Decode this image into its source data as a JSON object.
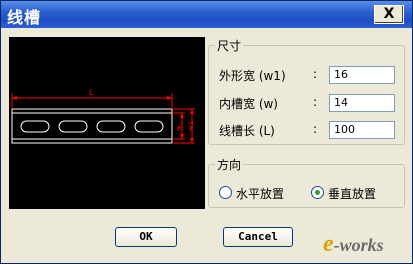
{
  "window": {
    "title": "线槽",
    "close_label": "X"
  },
  "preview": {
    "dim_l": "L",
    "dim_w": "w",
    "dim_w1": "w1"
  },
  "size_group": {
    "label": "尺寸",
    "rows": [
      {
        "label": "外形宽 (w1)",
        "value": "16"
      },
      {
        "label": "内槽宽 (w)",
        "value": "14"
      },
      {
        "label": "线槽长 (L)",
        "value": "100"
      }
    ],
    "colon": ":"
  },
  "direction_group": {
    "label": "方向",
    "options": [
      {
        "label": "水平放置",
        "checked": false
      },
      {
        "label": "垂直放置",
        "checked": true
      }
    ]
  },
  "buttons": {
    "ok": "OK",
    "cancel": "Cancel"
  },
  "watermark": {
    "e": "e",
    "rest": "-works"
  },
  "colors": {
    "titlebar": "#2b5fd0",
    "dimension": "#ff0000",
    "slot": "#ffffff"
  }
}
